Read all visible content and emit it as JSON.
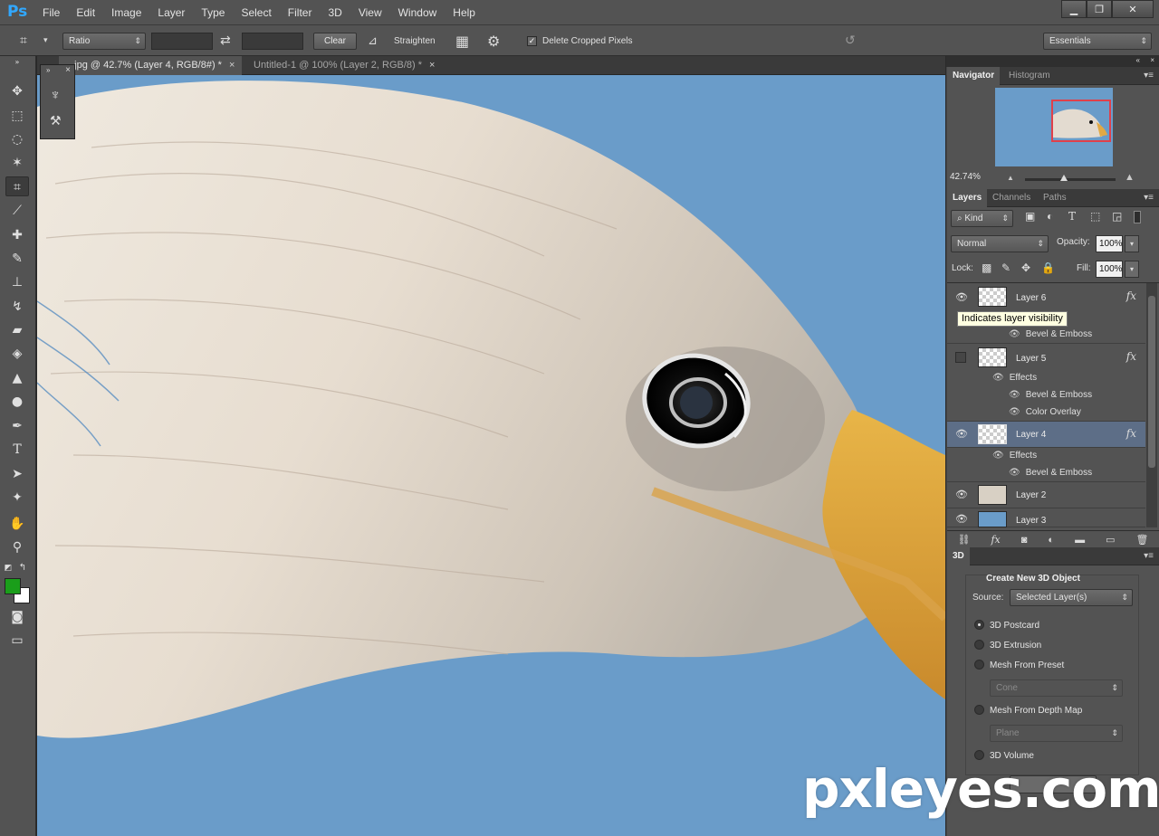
{
  "app": {
    "logo": "Ps"
  },
  "menu": [
    "File",
    "Edit",
    "Image",
    "Layer",
    "Type",
    "Select",
    "Filter",
    "3D",
    "View",
    "Window",
    "Help"
  ],
  "window_buttons": {
    "minimize": "▁",
    "restore": "❐",
    "close": "✕"
  },
  "options_bar": {
    "crop_icon": "crop-icon",
    "ratio_value": "Ratio",
    "swap_glyph": "⇄",
    "clear_label": "Clear",
    "straighten_label": "Straighten",
    "delete_cropped_label": "Delete Cropped Pixels",
    "delete_cropped_checked": true,
    "workspace_value": "Essentials"
  },
  "tabs": [
    {
      "title": "...jpg @ 42.7% (Layer 4, RGB/8#) *",
      "close": "×"
    },
    {
      "title": "Untitled-1 @ 100% (Layer 2, RGB/8) *",
      "close": "×"
    }
  ],
  "navigator": {
    "tabs": [
      "Navigator",
      "Histogram"
    ],
    "zoom": "42.74%",
    "zoom_fraction": 0.43
  },
  "layers_panel": {
    "tabs": [
      "Layers",
      "Channels",
      "Paths"
    ],
    "filter_kind": "Kind",
    "blend_mode": "Normal",
    "opacity_label": "Opacity:",
    "opacity_value": "100%",
    "lock_label": "Lock:",
    "fill_label": "Fill:",
    "fill_value": "100%",
    "layers": [
      {
        "name": "Layer 6",
        "visible": true,
        "fx": "fx",
        "effects_label": "",
        "effects": [
          "Bevel & Emboss"
        ]
      },
      {
        "name": "Layer 5",
        "visible": false,
        "fx": "fx",
        "effects_label": "Effects",
        "effects": [
          "Bevel & Emboss",
          "Color Overlay"
        ]
      },
      {
        "name": "Layer 4",
        "visible": true,
        "fx": "fx",
        "effects_label": "Effects",
        "effects": [
          "Bevel & Emboss"
        ],
        "selected": true
      },
      {
        "name": "Layer 2",
        "visible": true
      },
      {
        "name": "Layer 3",
        "visible": true
      }
    ],
    "tooltip": "Indicates layer visibility"
  },
  "panel_3d": {
    "tab": "3D",
    "section_title": "Create New 3D Object",
    "source_label": "Source:",
    "source_value": "Selected Layer(s)",
    "options": [
      {
        "label": "3D Postcard",
        "selected": true
      },
      {
        "label": "3D Extrusion",
        "selected": false
      },
      {
        "label": "Mesh From Preset",
        "selected": false,
        "sub_value": "Cone"
      },
      {
        "label": "Mesh From Depth Map",
        "selected": false,
        "sub_value": "Plane"
      },
      {
        "label": "3D Volume",
        "selected": false
      }
    ]
  },
  "watermark": "pxleyes.com",
  "colors": {
    "foreground": "#1a9e1a",
    "background": "#ffffff",
    "canvas_bg": "#6a9cc9",
    "selected_layer": "#5d6e87"
  }
}
